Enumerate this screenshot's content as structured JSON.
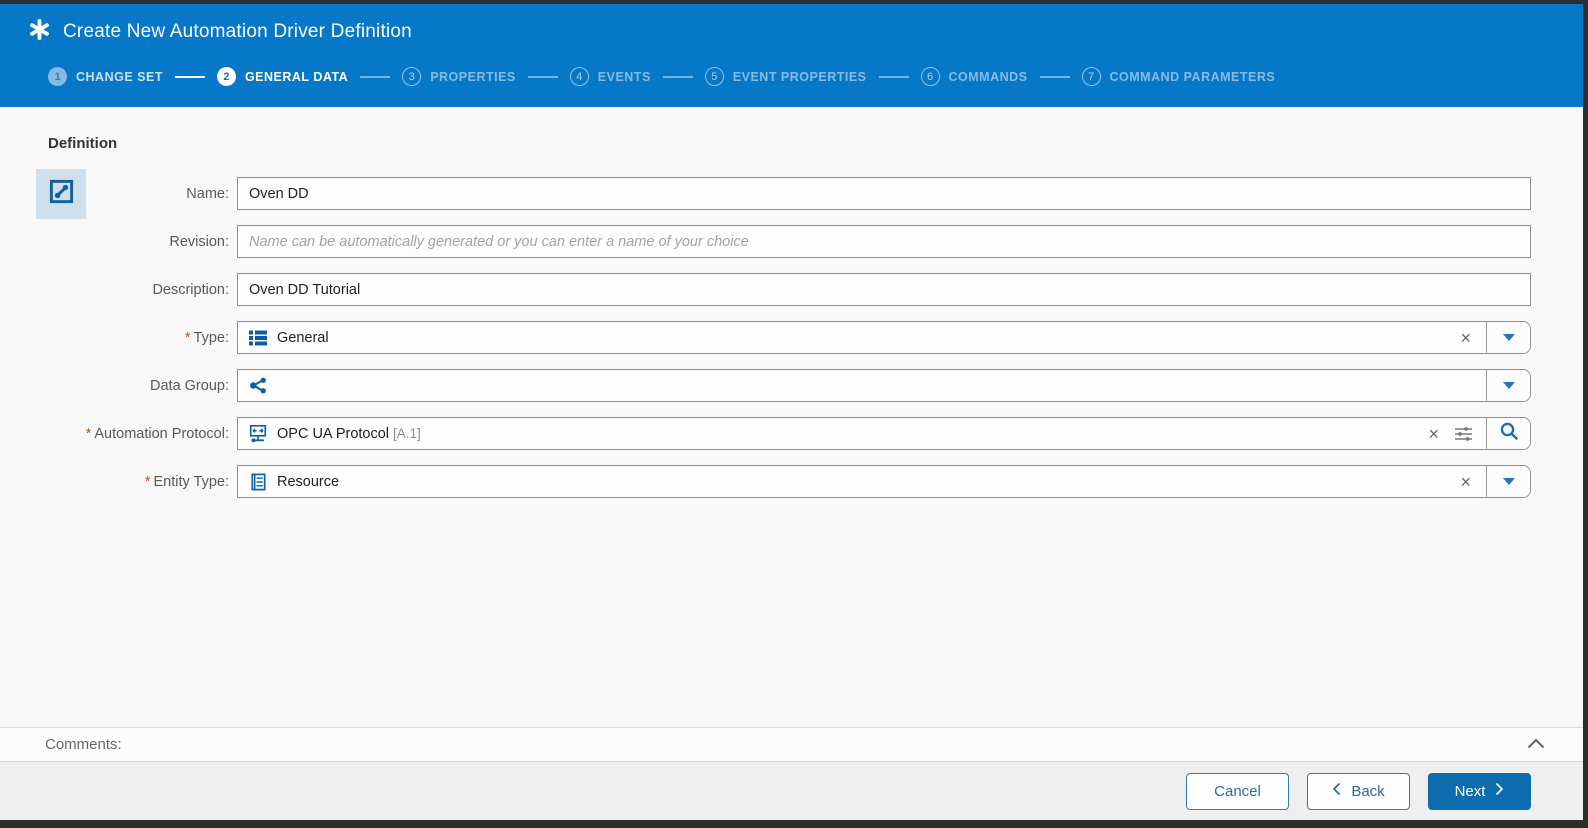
{
  "header": {
    "title": "Create New Automation Driver Definition",
    "steps": [
      {
        "num": "1",
        "label": "CHANGE SET",
        "state": "completed"
      },
      {
        "num": "2",
        "label": "GENERAL DATA",
        "state": "active"
      },
      {
        "num": "3",
        "label": "PROPERTIES",
        "state": "future"
      },
      {
        "num": "4",
        "label": "EVENTS",
        "state": "future"
      },
      {
        "num": "5",
        "label": "EVENT PROPERTIES",
        "state": "future"
      },
      {
        "num": "6",
        "label": "COMMANDS",
        "state": "future"
      },
      {
        "num": "7",
        "label": "COMMAND PARAMETERS",
        "state": "future"
      }
    ]
  },
  "form": {
    "section_title": "Definition",
    "required_marker": "*",
    "fields": [
      {
        "label": "Name:",
        "required": false,
        "type": "text",
        "value": "Oven DD"
      },
      {
        "label": "Revision:",
        "required": false,
        "type": "text",
        "value": "",
        "placeholder": "Name can be automatically generated or you can enter a name of your choice"
      },
      {
        "label": "Description:",
        "required": false,
        "type": "text",
        "value": "Oven DD Tutorial"
      },
      {
        "label": "Type:",
        "required": true,
        "type": "combo",
        "value": "General",
        "icon": "list-icon",
        "controls": [
          "clear",
          "dropdown"
        ]
      },
      {
        "label": "Data Group:",
        "required": false,
        "type": "combo",
        "value": "",
        "icon": "share-icon",
        "controls": [
          "dropdown"
        ]
      },
      {
        "label": "Automation Protocol:",
        "required": true,
        "type": "lookup",
        "value": "OPC UA Protocol",
        "suffix": "[A.1]",
        "icon": "network-icon",
        "controls": [
          "clear",
          "sliders",
          "search"
        ]
      },
      {
        "label": "Entity Type:",
        "required": true,
        "type": "combo",
        "value": "Resource",
        "icon": "document-icon",
        "controls": [
          "clear",
          "dropdown"
        ]
      }
    ]
  },
  "comments": {
    "label": "Comments:"
  },
  "footer": {
    "cancel_label": "Cancel",
    "back_label": "Back",
    "next_label": "Next"
  },
  "icons": {
    "clear_glyph": "×"
  },
  "colors": {
    "header_bg": "#0777c8",
    "accent_blue": "#0d6cac",
    "icon_blue": "#0f5fa0",
    "required": "#b2502b"
  }
}
